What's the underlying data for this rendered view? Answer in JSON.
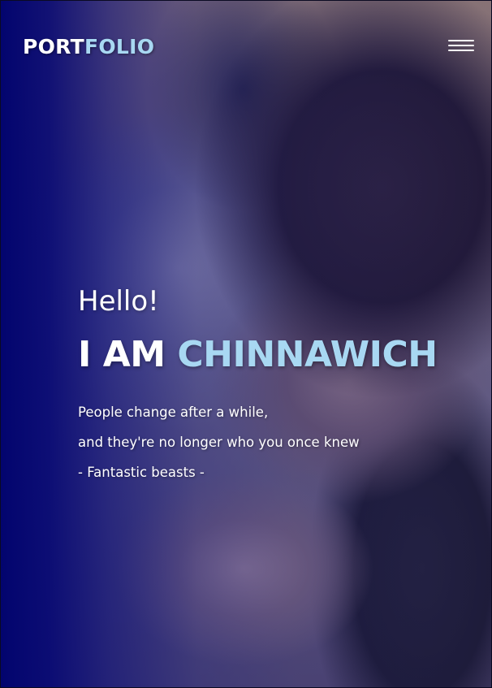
{
  "nav": {
    "brand_part1": "PORT",
    "brand_part2": "FOLIO",
    "menu_icon": "hamburger-menu-icon"
  },
  "hero": {
    "greeting": "Hello!",
    "name_prefix": "I AM",
    "name": "CHINNAWICH",
    "quote_line1": "People change after a while,",
    "quote_line2": "and they're no longer who you once knew",
    "quote_source": "- Fantastic beasts -"
  },
  "colors": {
    "accent": "#a8d8f2",
    "overlay": "#02046e",
    "text": "#ffffff"
  }
}
